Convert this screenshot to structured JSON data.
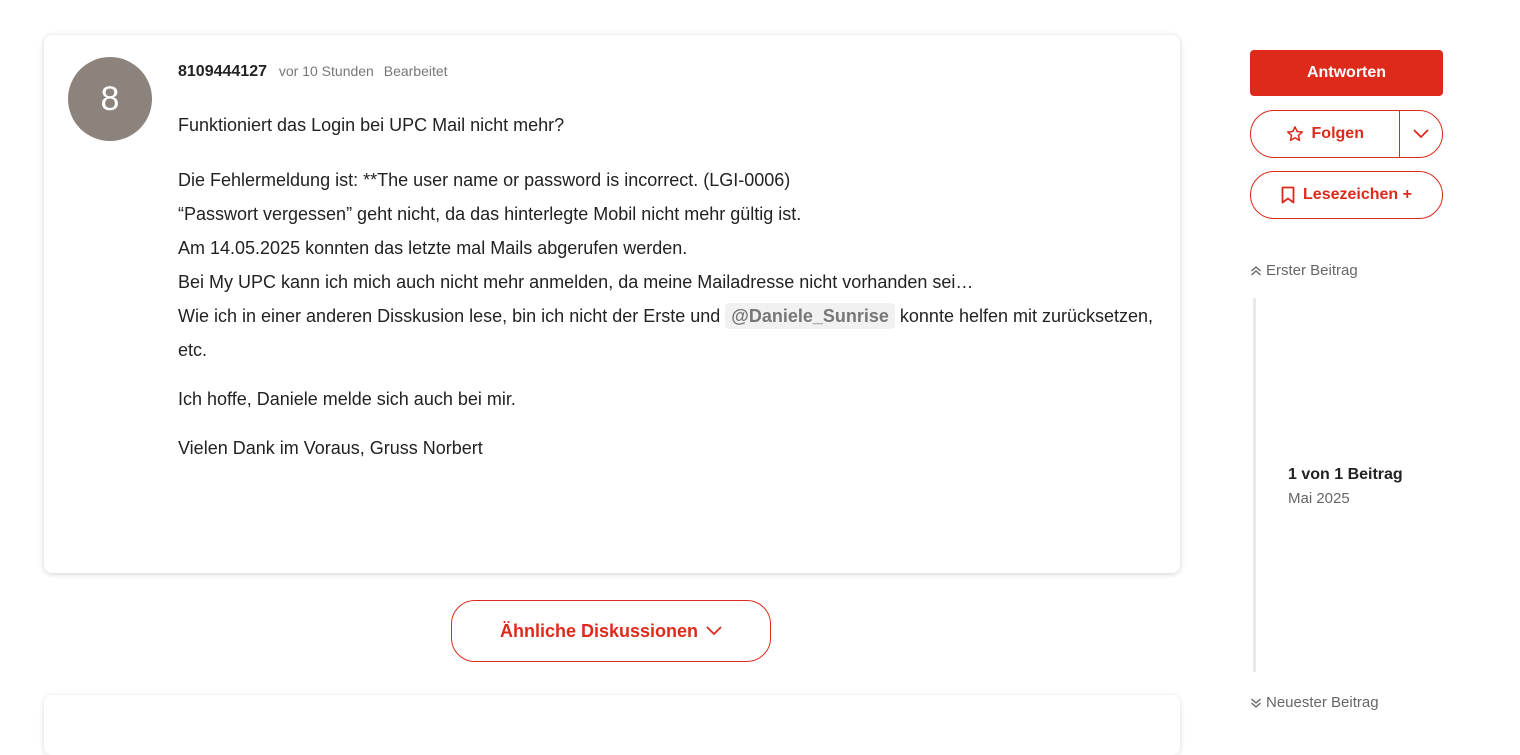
{
  "post": {
    "avatar_letter": "8",
    "author": "8109444127",
    "time": "vor 10 Stunden",
    "edited": "Bearbeitet",
    "title": "Funktioniert das Login bei UPC Mail nicht mehr?",
    "body": {
      "line1": "Die Fehlermeldung ist: **The user name or password is incorrect. (LGI-0006)",
      "line2": "“Passwort vergessen” geht nicht, da das hinterlegte Mobil nicht mehr gültig ist.",
      "line3": "Am 14.05.2025 konnten das letzte mal Mails abgerufen werden.",
      "line4": "Bei My UPC kann ich mich auch nicht mehr anmelden, da meine Mailadresse nicht vorhanden sei…",
      "line5_before": "Wie ich in einer anderen Disskusion lese, bin ich nicht der Erste und ",
      "mention": "@Daniele_Sunrise",
      "line5_after": " konnte helfen mit zurücksetzen, etc.",
      "para2": "Ich hoffe, Daniele melde sich auch bei mir.",
      "para3": "Vielen Dank im Voraus, Gruss Norbert"
    }
  },
  "similar": {
    "label": "Ähnliche Diskussionen"
  },
  "sidebar": {
    "reply": "Antworten",
    "follow": "Folgen",
    "bookmark": "Lesezeichen +",
    "first_post": "Erster Beitrag",
    "position": "1 von 1 Beitrag",
    "date": "Mai 2025",
    "latest_post": "Neuester Beitrag"
  },
  "colors": {
    "accent": "#dd2a1b",
    "avatar": "#8c847c"
  },
  "icons": [
    "star-icon",
    "chevron-down-icon",
    "bookmark-icon",
    "double-chevron-up-icon",
    "double-chevron-down-icon"
  ]
}
